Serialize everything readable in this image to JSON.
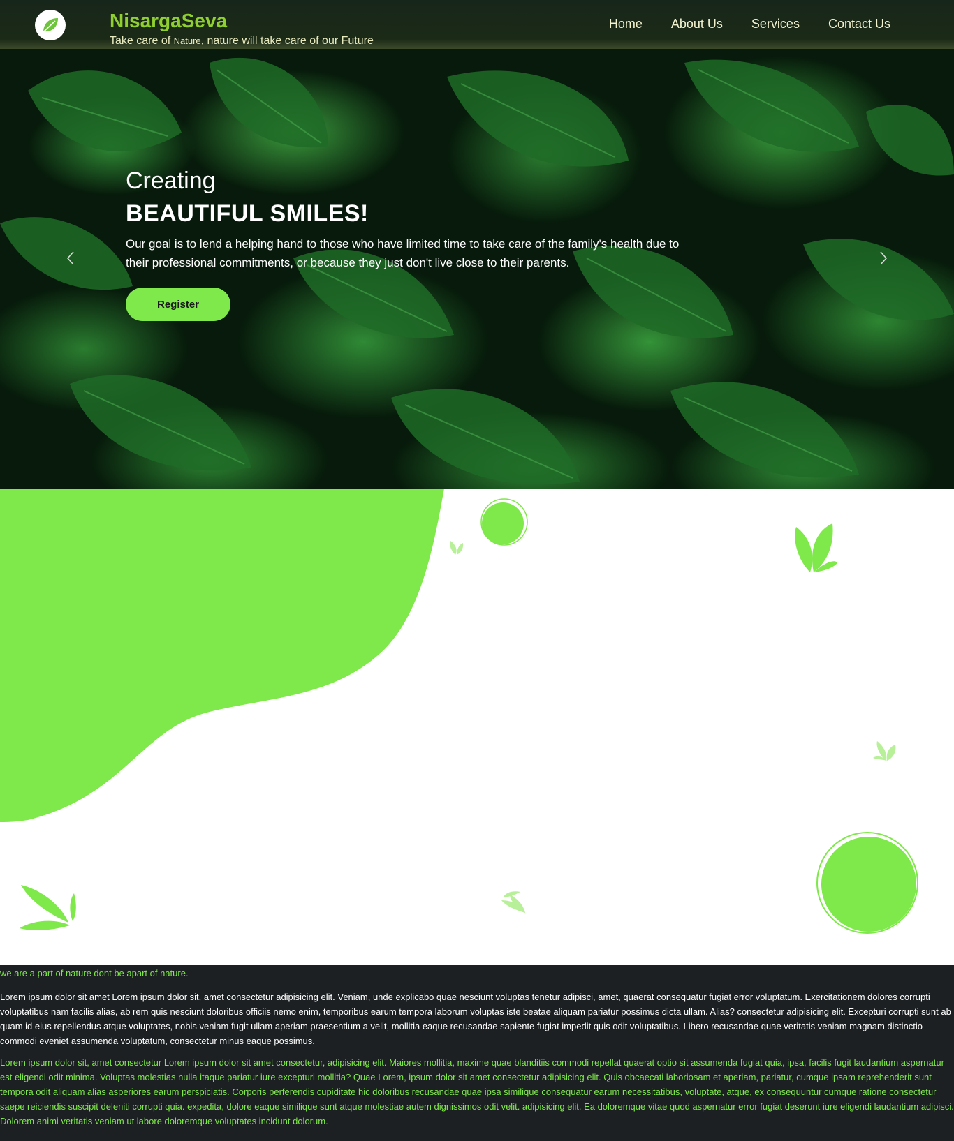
{
  "header": {
    "brand": "NisargaSeva",
    "tagline_part1": "Take care of ",
    "tagline_small": "Nature",
    "tagline_part2": ", nature will take care of our Future",
    "logo_icon": "leaf-icon",
    "nav": [
      {
        "label": "Home"
      },
      {
        "label": "About Us"
      },
      {
        "label": "Services"
      },
      {
        "label": "Contact Us"
      }
    ]
  },
  "hero": {
    "subtitle": "Creating",
    "title": "BEAUTIFUL SMILES!",
    "description": "Our goal is to lend a helping hand to those who have limited time to take care of the family's health due to their professional commitments, or because they just don't live close to their parents.",
    "register_label": "Register",
    "prev_icon": "chevron-left-icon",
    "next_icon": "chevron-right-icon"
  },
  "about": {
    "tagline": "we are a part of nature dont be apart of nature.",
    "paragraph1": "Lorem ipsum dolor sit amet Lorem ipsum dolor sit, amet consectetur adipisicing elit. Veniam, unde explicabo quae nesciunt voluptas tenetur adipisci, amet, quaerat consequatur fugiat error voluptatum. Exercitationem dolores corrupti voluptatibus nam facilis alias, ab rem quis nesciunt doloribus officiis nemo enim, temporibus earum tempora laborum voluptas iste beatae aliquam pariatur possimus dicta ullam. Alias? consectetur adipisicing elit. Excepturi corrupti sunt ab quam id eius repellendus atque voluptates, nobis veniam fugit ullam aperiam praesentium a velit, mollitia eaque recusandae sapiente fugiat impedit quis odit voluptatibus. Libero recusandae quae veritatis veniam magnam distinctio commodi eveniet assumenda voluptatum, consectetur minus eaque possimus.",
    "paragraph2": "Lorem ipsum dolor sit, amet consectetur Lorem ipsum dolor sit amet consectetur, adipisicing elit. Maiores mollitia, maxime quae blanditiis commodi repellat quaerat optio sit assumenda fugiat quia, ipsa, facilis fugit laudantium aspernatur est eligendi odit minima. Voluptas molestias nulla itaque pariatur iure excepturi mollitia? Quae Lorem, ipsum dolor sit amet consectetur adipisicing elit. Quis obcaecati laboriosam et aperiam, pariatur, cumque ipsam reprehenderit sunt tempora odit aliquam alias asperiores earum perspiciatis. Corporis perferendis cupiditate hic doloribus recusandae quae ipsa similique consequatur earum necessitatibus, voluptate, atque, ex consequuntur cumque ratione consectetur saepe reiciendis suscipit deleniti corrupti quia. expedita, dolore eaque similique sunt atque molestiae autem dignissimos odit velit. adipisicing elit. Ea doloremque vitae quod aspernatur error fugiat deserunt iure eligendi laudantium adipisci. Dolorem animi veritatis veniam ut labore doloremque voluptates incidunt dolorum."
  },
  "colors": {
    "accent_green": "#7fe84a",
    "brand_green": "#8fcf2f",
    "navbar_bg": "#1b2a17",
    "footer_bg": "#1c2023"
  }
}
